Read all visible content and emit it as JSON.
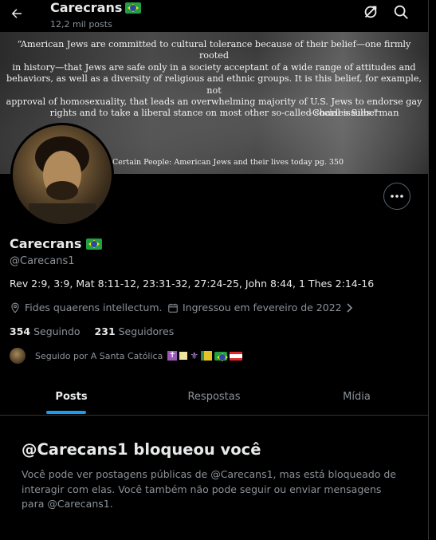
{
  "header": {
    "name": "Carecrans",
    "flag": "brazil-flag",
    "post_count": "12,2 mil posts"
  },
  "banner": {
    "quote_lines": [
      "“American Jews are committed to cultural tolerance because of their belief—one firmly rooted",
      "in history—that Jews are safe only in a society acceptant of a wide range of attitudes and",
      "behaviors, as well as a diversity of religious and ethnic groups. It is this belief, for example, not",
      "approval of homosexuality, that leads an overwhelming majority of U.S. Jews to endorse gay",
      "rights and to take a liberal stance on most other so-called social issues.”"
    ],
    "author": "-Charles Silberman",
    "source": "Certain People: American Jews and their lives today pg. 350"
  },
  "profile": {
    "name": "Carecrans",
    "handle": "@Carecans1",
    "bio": "Rev 2:9, 3:9, Mat 8:11-12, 23:31-32, 27:24-25, John 8:44, 1 Thes 2:14-16",
    "location": "Fides quaerens intellectum.",
    "joined": "Ingressou em fevereiro de 2022",
    "following_count": "354",
    "following_label": "Seguindo",
    "followers_count": "231",
    "followers_label": "Seguidores",
    "followed_by": "Seguido por A Santa Católica"
  },
  "tabs": [
    {
      "label": "Posts",
      "active": true
    },
    {
      "label": "Respostas",
      "active": false
    },
    {
      "label": "Mídia",
      "active": false
    }
  ],
  "blocked": {
    "title": "@Carecans1 bloqueou você",
    "text": "Você pode ver postagens públicas de @Carecans1, mas está bloqueado de interagir com elas. Você também não pode seguir ou enviar mensagens para @Carecans1."
  },
  "colors": {
    "accent": "#1d9bf0",
    "muted": "#8b9298",
    "text": "#e7e9ea",
    "background": "#000000"
  }
}
